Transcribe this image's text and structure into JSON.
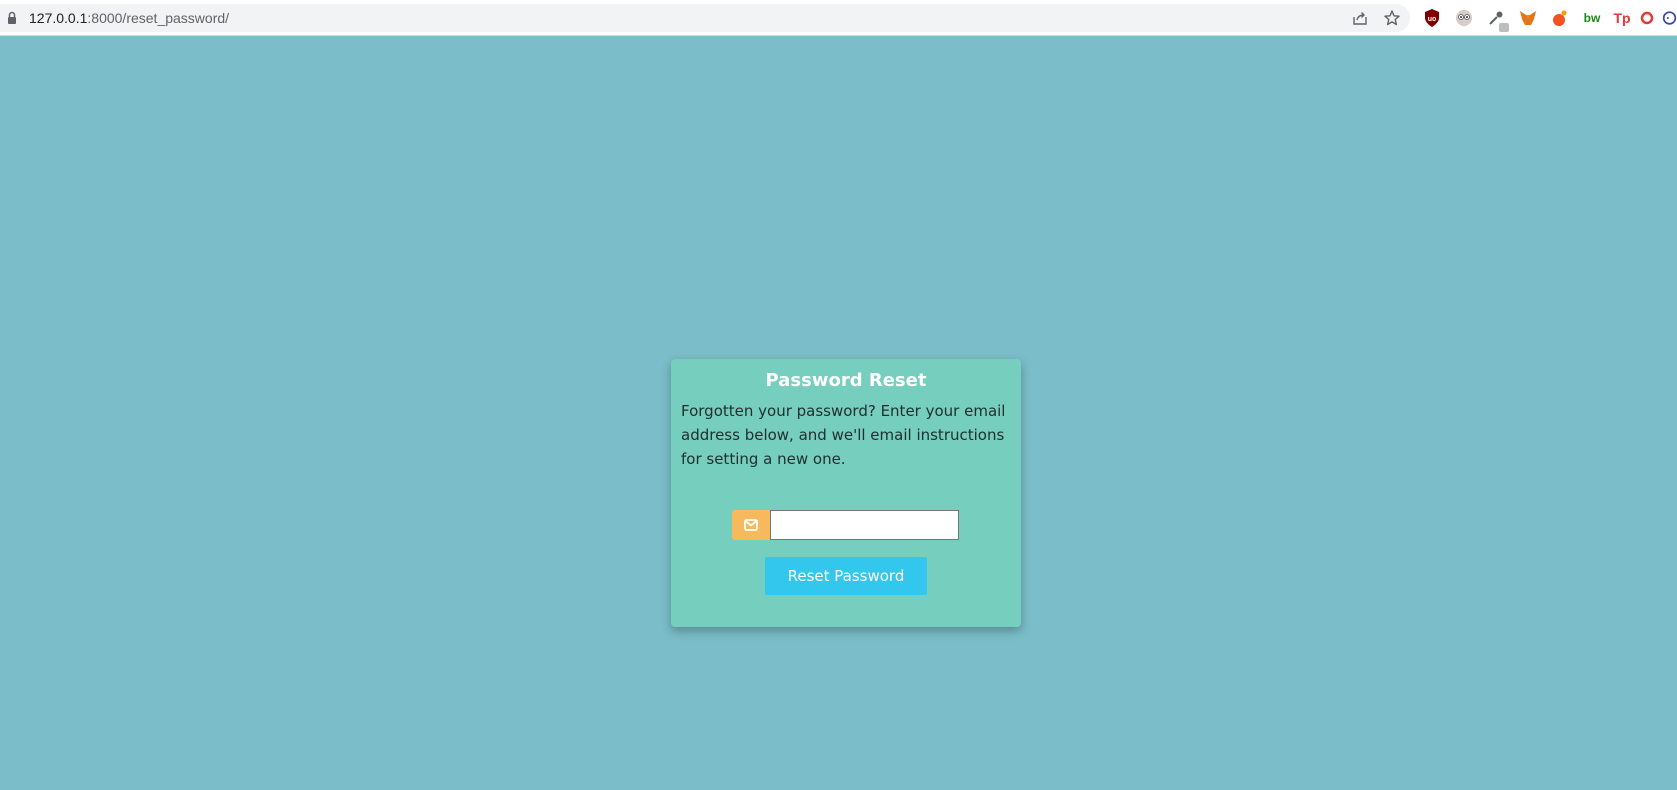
{
  "browser": {
    "url_host": "127.0.0.1",
    "url_rest": ":8000/reset_password/",
    "share_icon": "share-icon",
    "bookmark_icon": "star-icon",
    "extensions": [
      {
        "name": "ublock-origin",
        "label": "uo",
        "color": "#800000"
      },
      {
        "name": "eyes-extension",
        "label": "",
        "color": "#9e9e9e"
      },
      {
        "name": "eyedropper-extension",
        "label": "",
        "color": "#5f6368"
      },
      {
        "name": "metamask-fox",
        "label": "",
        "color": "#e2761b"
      },
      {
        "name": "orange-extension",
        "label": "",
        "color": "#f4511e"
      },
      {
        "name": "bw-extension",
        "label": "bw",
        "color": "#1b8a1b"
      },
      {
        "name": "tp-extension",
        "label": "Tp",
        "color": "#e53935"
      },
      {
        "name": "red-partial-extension",
        "label": "",
        "color": "#e53935"
      },
      {
        "name": "blue-partial-extension",
        "label": "",
        "color": "#3949ab"
      }
    ]
  },
  "colors": {
    "page_background": "#7bbdc8",
    "card_background": "#75cebe",
    "addon_background": "#f6b95b",
    "button_background": "#34c7ee"
  },
  "card": {
    "title": "Password Reset",
    "description": "Forgotten your password? Enter your email address below, and we'll email instructions for setting a new one.",
    "email_icon": "envelope-icon",
    "email_value": "",
    "email_placeholder": "",
    "button_label": "Reset Password"
  }
}
